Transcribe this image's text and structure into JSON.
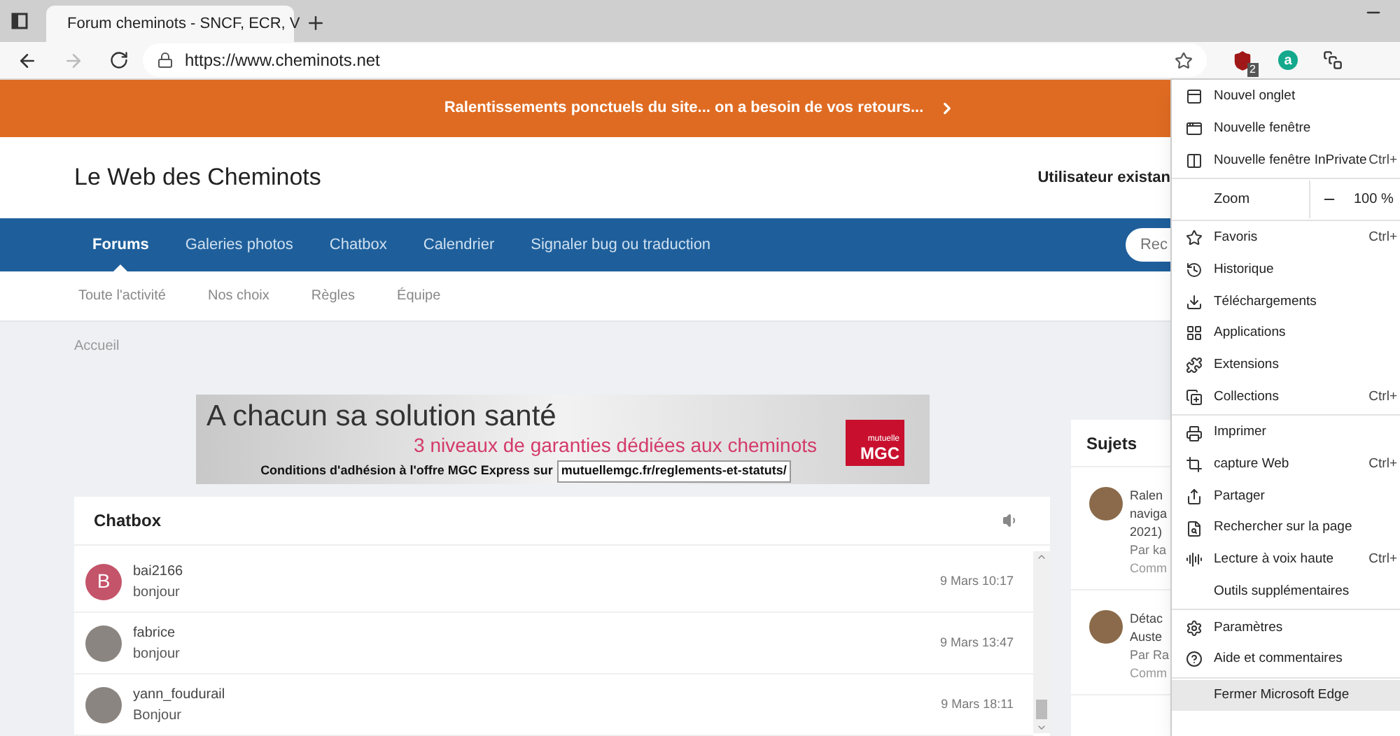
{
  "browser": {
    "tab_title": "Forum cheminots - SNCF, ECR, V",
    "url": "https://www.cheminots.net",
    "extension_badge": "2",
    "extension_letter": "a"
  },
  "banner": {
    "text": "Ralentissements ponctuels du site... on a besoin de vos retours..."
  },
  "header": {
    "site_title": "Le Web des Cheminots",
    "user_text": "Utilisateur existan"
  },
  "nav": {
    "items": [
      {
        "label": "Forums",
        "selected": true
      },
      {
        "label": "Galeries photos",
        "selected": false
      },
      {
        "label": "Chatbox",
        "selected": false
      },
      {
        "label": "Calendrier",
        "selected": false
      },
      {
        "label": "Signaler bug ou traduction",
        "selected": false
      }
    ],
    "search_button": "Rec"
  },
  "subnav": [
    "Toute l'activité",
    "Nos choix",
    "Règles",
    "Équipe"
  ],
  "breadcrumb": "Accueil",
  "ad": {
    "headline": "A chacun sa solution santé",
    "subline": "3 niveaux de garanties dédiées aux cheminots",
    "conditions": "Conditions d'adhésion à l'offre MGC Express sur",
    "link": "mutuellemgc.fr/reglements-et-statuts/",
    "logo_top": "mutuelle",
    "logo": "MGC"
  },
  "chatbox": {
    "title": "Chatbox",
    "messages": [
      {
        "user": "bai2166",
        "text": "bonjour",
        "time": "9 Mars 10:17",
        "avatar": {
          "kind": "letter",
          "letter": "B",
          "color": "#c4546a"
        }
      },
      {
        "user": "fabrice",
        "text": "bonjour",
        "time": "9 Mars 13:47",
        "avatar": {
          "kind": "photo"
        }
      },
      {
        "user": "yann_foudurail",
        "text": "Bonjour",
        "time": "9 Mars 18:11",
        "avatar": {
          "kind": "photo"
        }
      }
    ]
  },
  "sidebar": {
    "title": "Sujets",
    "topics": [
      {
        "lines": [
          "Ralen",
          "naviga",
          "2021)"
        ],
        "author": "Par ka",
        "meta": "Comm"
      },
      {
        "lines": [
          "Détac",
          "Auste"
        ],
        "author": "Par Ra",
        "meta": "Comm"
      }
    ]
  },
  "menu": {
    "groups": [
      [
        {
          "kind": "item",
          "label": "Nouvel onglet",
          "highlighted": false
        },
        {
          "kind": "item",
          "label": "Nouvelle fenêtre",
          "highlighted": false
        },
        {
          "kind": "item",
          "label": "Nouvelle fenêtre InPrivate",
          "shortcut": "Ctrl+",
          "highlighted": false
        }
      ],
      [
        {
          "kind": "zoom",
          "label": "Zoom",
          "value": "100 %",
          "highlighted": false
        }
      ],
      [
        {
          "kind": "item",
          "label": "Favoris",
          "shortcut": "Ctrl+",
          "highlighted": false
        },
        {
          "kind": "item",
          "label": "Historique",
          "highlighted": false
        },
        {
          "kind": "item",
          "label": "Téléchargements",
          "highlighted": false
        },
        {
          "kind": "item",
          "label": "Applications",
          "highlighted": false
        },
        {
          "kind": "item",
          "label": "Extensions",
          "highlighted": false
        },
        {
          "kind": "item",
          "label": "Collections",
          "shortcut": "Ctrl+",
          "highlighted": false
        }
      ],
      [
        {
          "kind": "item",
          "label": "Imprimer",
          "highlighted": false
        },
        {
          "kind": "item",
          "label": "capture Web",
          "shortcut": "Ctrl+",
          "highlighted": false
        },
        {
          "kind": "item",
          "label": "Partager",
          "highlighted": false
        },
        {
          "kind": "item",
          "label": "Rechercher sur la page",
          "highlighted": false
        },
        {
          "kind": "item",
          "label": "Lecture à voix haute",
          "shortcut": "Ctrl+",
          "highlighted": false
        },
        {
          "kind": "item",
          "label": "Outils supplémentaires",
          "highlighted": false
        }
      ],
      [
        {
          "kind": "item",
          "label": "Paramètres",
          "highlighted": false
        },
        {
          "kind": "item",
          "label": "Aide et commentaires",
          "highlighted": false
        }
      ],
      [
        {
          "kind": "item",
          "label": "Fermer Microsoft Edge",
          "highlighted": true
        }
      ]
    ]
  }
}
